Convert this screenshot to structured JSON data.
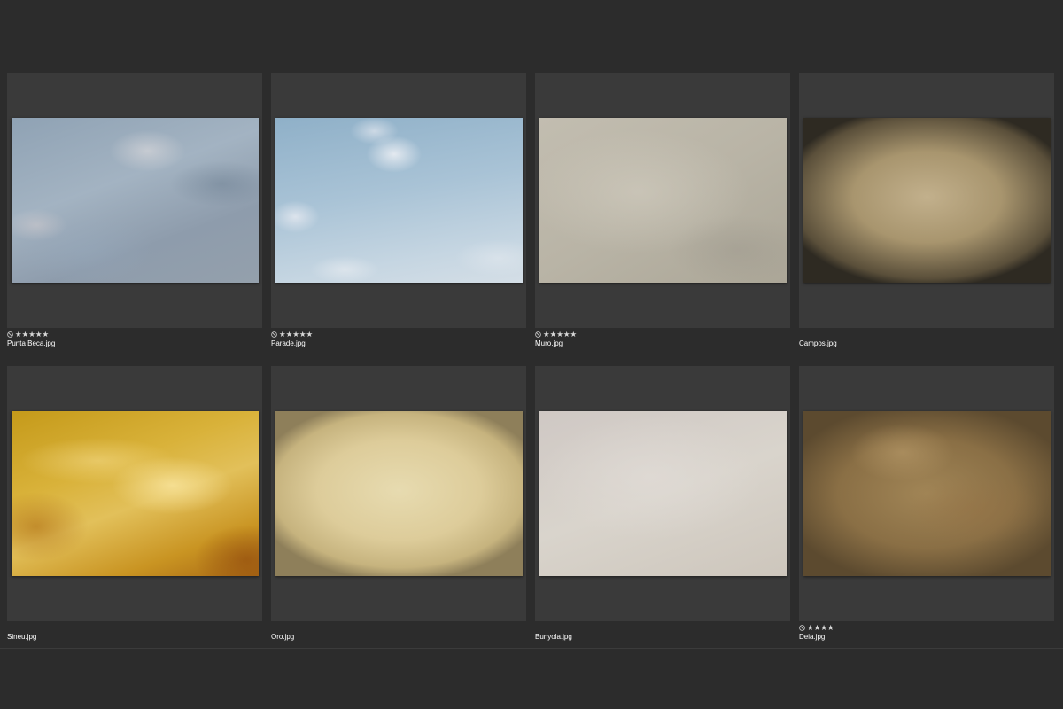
{
  "colors": {
    "background": "#2c2c2c",
    "cell": "#3a3a3a",
    "stars": "#d8d8d8",
    "filename": "#ffffff"
  },
  "items": [
    {
      "filename": "Punta Beca.jpg",
      "stars": "★★★★★",
      "rating": 5,
      "reject_flag": true,
      "texture": "blue-sky-grunge"
    },
    {
      "filename": "Parade.jpg",
      "stars": "★★★★★",
      "rating": 5,
      "reject_flag": true,
      "texture": "light-blue-sky"
    },
    {
      "filename": "Muro.jpg",
      "stars": "★★★★★",
      "rating": 5,
      "reject_flag": true,
      "texture": "grey-stone-wall"
    },
    {
      "filename": "Campos.jpg",
      "stars": "",
      "rating": 0,
      "reject_flag": false,
      "texture": "dark-vignette-parchment"
    },
    {
      "filename": "Sineu.jpg",
      "stars": "",
      "rating": 0,
      "reject_flag": false,
      "texture": "golden-yellow-paint"
    },
    {
      "filename": "Oro.jpg",
      "stars": "",
      "rating": 0,
      "reject_flag": false,
      "texture": "cream-parchment"
    },
    {
      "filename": "Bunyola.jpg",
      "stars": "",
      "rating": 0,
      "reject_flag": false,
      "texture": "white-plaster"
    },
    {
      "filename": "Deia.jpg",
      "stars": "★★★★",
      "rating": 4,
      "reject_flag": true,
      "texture": "brown-brushstroke"
    }
  ]
}
